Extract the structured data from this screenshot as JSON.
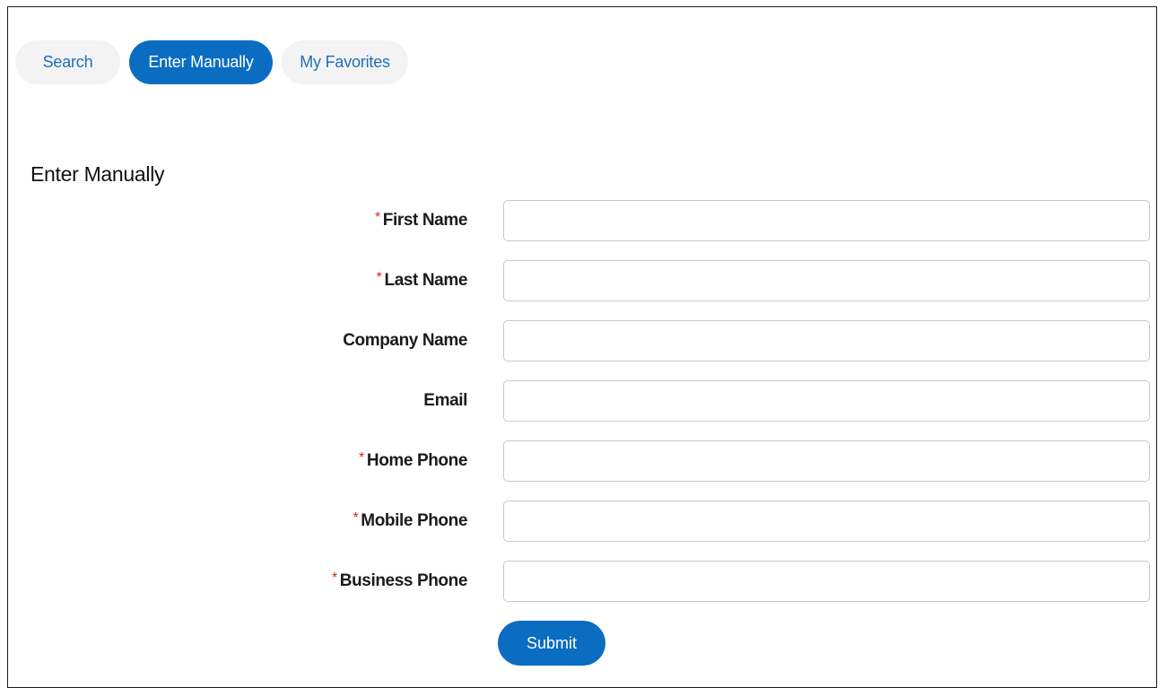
{
  "tabs": {
    "search": "Search",
    "enter_manually": "Enter Manually",
    "my_favorites": "My Favorites",
    "active": "Enter Manually"
  },
  "section_title": "Enter Manually",
  "form": {
    "fields": [
      {
        "label": "First Name",
        "required": true,
        "value": ""
      },
      {
        "label": "Last Name",
        "required": true,
        "value": ""
      },
      {
        "label": "Company Name",
        "required": false,
        "value": ""
      },
      {
        "label": "Email",
        "required": false,
        "value": ""
      },
      {
        "label": "Home Phone",
        "required": true,
        "value": ""
      },
      {
        "label": "Mobile Phone",
        "required": true,
        "value": ""
      },
      {
        "label": "Business Phone",
        "required": true,
        "value": ""
      }
    ],
    "required_marker": "*",
    "submit_label": "Submit"
  },
  "colors": {
    "accent": "#0a6dc2",
    "link": "#1f6fb8",
    "required": "#d8261a",
    "tab_bg": "#f3f3f3"
  }
}
